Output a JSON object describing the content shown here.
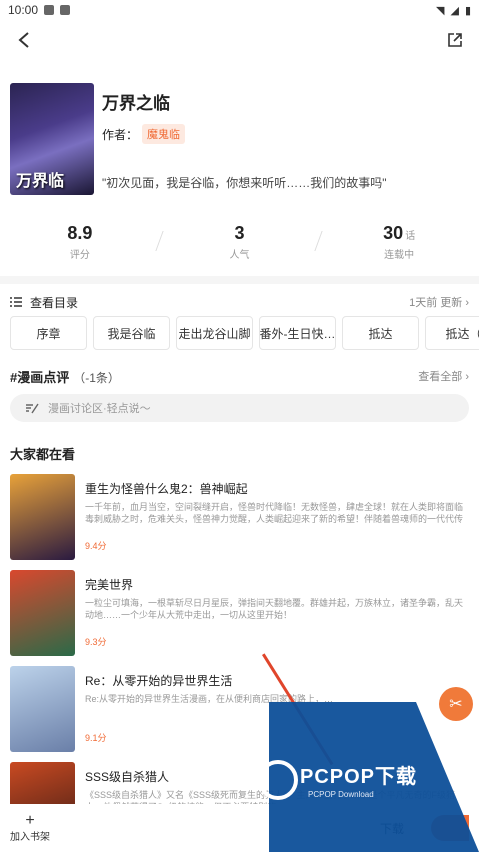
{
  "status": {
    "time": "10:00"
  },
  "comic": {
    "cover_text": "万界临",
    "title": "万界之临",
    "author_label": "作者：",
    "author": "魔鬼临",
    "desc": "\"初次见面，我是谷临，你想来听听……我们的故事吗\""
  },
  "stats": [
    {
      "value": "8.9",
      "unit": "",
      "label": "评分"
    },
    {
      "value": "3",
      "unit": "",
      "label": "人气"
    },
    {
      "value": "30",
      "unit": "话",
      "label": "连载中"
    }
  ],
  "catalog": {
    "label": "查看目录",
    "update": "1天前 更新 ›"
  },
  "chapters": [
    "序章",
    "我是谷临",
    "走出龙谷山脚",
    "番外-生日快…",
    "抵达",
    "抵达（"
  ],
  "review": {
    "title": "#漫画点评",
    "count": "（-1条）",
    "all": "查看全部 ›",
    "placeholder": "漫画讨论区·轻点说～"
  },
  "section_title": "大家都在看",
  "recommendations": [
    {
      "name": "重生为怪兽什么鬼2：兽神崛起",
      "intro": "一千年前，血月当空，空间裂缝开启，怪兽时代降临！无数怪兽，肆虐全球！就在人类即将面临毒刺威胁之时，危难关头，怪兽神力觉醒，人类崛起迎来了新的希望！伴随着兽魂师的一代代传承与发展…",
      "score": "9.4分",
      "color1": "#e8a23a",
      "color2": "#2a1a40"
    },
    {
      "name": "完美世界",
      "intro": "一粒尘可填海，一根草斩尽日月星辰，弹指间天翻地覆。群雄并起，万族林立，诸圣争霸，乱天动地……一个少年从大荒中走出，一切从这里开始！",
      "score": "9.3分",
      "color1": "#d9482e",
      "color2": "#2a6a48"
    },
    {
      "name": "Re：从零开始的异世界生活",
      "intro": "Re:从零开始的异世界生活漫画，在从便利商店回家的路上，…",
      "score": "9.1分",
      "color1": "#bcd2ea",
      "color2": "#6a7fa8"
    },
    {
      "name": "SSS级自杀猎人",
      "intro": "《SSS级自杀猎人》又名《SSS级死而复生的猎人》。主人公金孔子原本是个平凡无奇的F级猎人，他偶然获得了S+级的技能。但不必要特别的…",
      "score": "",
      "color1": "#c94a22",
      "color2": "#3a1a14"
    }
  ],
  "bottom": {
    "add_shelf": "加入书架",
    "download": "下载"
  },
  "watermark": {
    "text": "PCPOP下载",
    "sub": "PCPOP Download"
  }
}
